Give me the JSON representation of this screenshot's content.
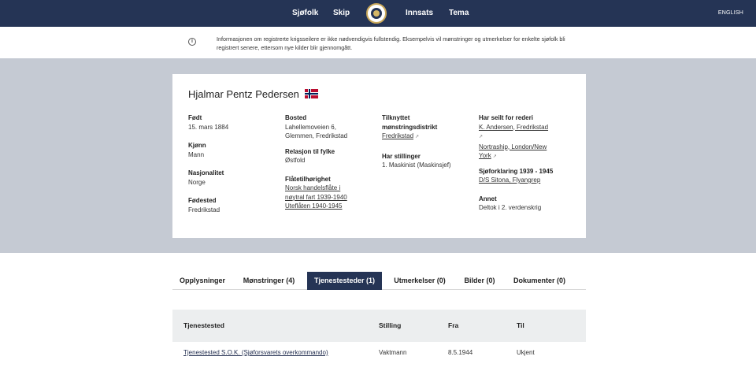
{
  "nav": {
    "items": [
      "Sjøfolk",
      "Skip",
      "Innsats",
      "Tema"
    ],
    "language": "ENGLISH"
  },
  "info": {
    "text": "Informasjonen om registrerte krigsseilere er ikke nødvendigvis fullstendig. Eksempelvis vil mønstringer og utmerkelser for enkelte sjøfolk bli registrert senere, ettersom nye kilder blir gjennomgått."
  },
  "person": {
    "name": "Hjalmar Pentz Pedersen",
    "col1": {
      "fodt_label": "Født",
      "fodt": "15. mars 1884",
      "kjonn_label": "Kjønn",
      "kjonn": "Mann",
      "nasjonalitet_label": "Nasjonalitet",
      "nasjonalitet": "Norge",
      "fodested_label": "Fødested",
      "fodested": "Fredrikstad"
    },
    "col2": {
      "bosted_label": "Bosted",
      "bosted_1": "Lahellemoveien 6,",
      "bosted_2": "Glemmen, Fredrikstad",
      "relasjon_label": "Relasjon til fylke",
      "relasjon": "Østfold",
      "flate_label": "Flåtetilhørighet",
      "flate_1a": "Norsk handelsflåte i",
      "flate_1b": "nøytral fart 1939-1940",
      "flate_2": "Uteflåten 1940-1945"
    },
    "col3": {
      "distrikt_label_1": "Tilknyttet",
      "distrikt_label_2": "mønstringsdistrikt",
      "distrikt": "Fredrikstad",
      "stillinger_label": "Har stillinger",
      "stillinger": "1. Maskinist (Maskinsjef)"
    },
    "col4": {
      "rederi_label": "Har seilt for rederi",
      "rederi_1": "K. Andersen, Fredrikstad",
      "rederi_2a": "Nortraship, London/New",
      "rederi_2b": "York",
      "sjoforklaring_label": "Sjøforklaring 1939 - 1945",
      "sjoforklaring": "D/S Sitona, Flyangrep",
      "annet_label": "Annet",
      "annet": "Deltok i 2. verdenskrig"
    }
  },
  "tabs": [
    "Opplysninger",
    "Mønstringer (4)",
    "Tjenestesteder (1)",
    "Utmerkelser (0)",
    "Bilder (0)",
    "Dokumenter (0)"
  ],
  "active_tab": "Tjenestesteder (1)",
  "table": {
    "headers": [
      "Tjenestested",
      "Stilling",
      "Fra",
      "Til"
    ],
    "rows": [
      [
        "Tjenestested S.O.K. (Sjøforsvarets overkommando)",
        "Vaktmann",
        "8.5.1944",
        "Ukjent"
      ]
    ]
  },
  "colors": {
    "navy": "#253455",
    "hero_grey": "#c5cad3",
    "table_head": "#eceeef"
  }
}
